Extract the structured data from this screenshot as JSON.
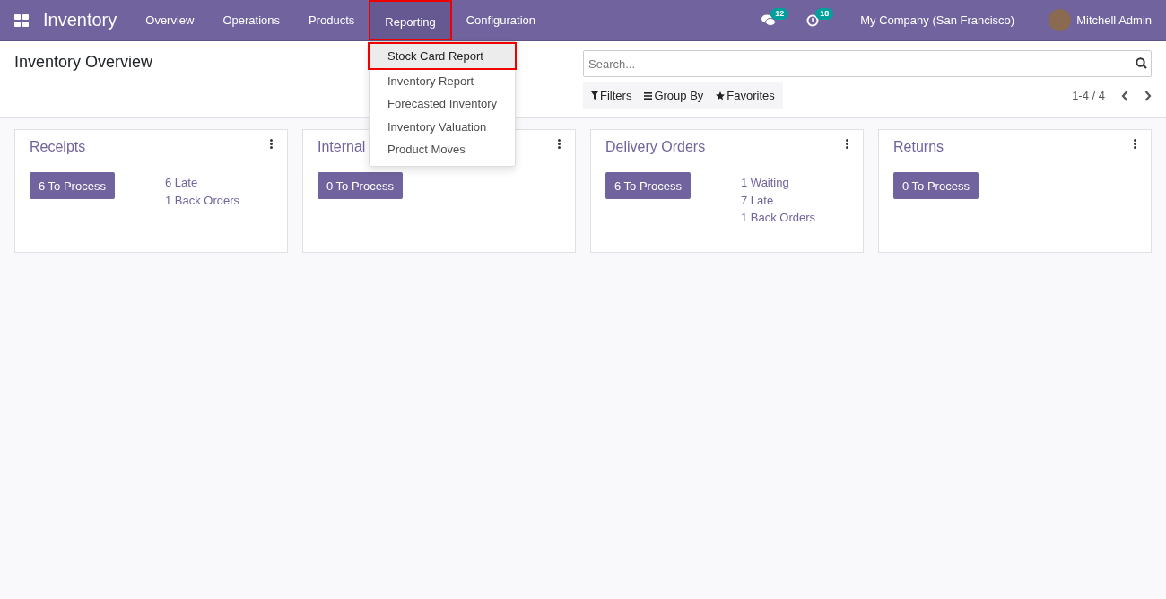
{
  "navbar": {
    "app_name": "Inventory",
    "menu": [
      {
        "label": "Overview",
        "selected": false,
        "annotated": false
      },
      {
        "label": "Operations",
        "selected": false,
        "annotated": false
      },
      {
        "label": "Products",
        "selected": false,
        "annotated": false
      },
      {
        "label": "Reporting",
        "selected": true,
        "annotated": true
      },
      {
        "label": "Configuration",
        "selected": false,
        "annotated": false
      }
    ],
    "messages_count": "12",
    "activities_count": "18",
    "company": "My Company (San Francisco)",
    "user": "Mitchell Admin"
  },
  "dropdown": [
    {
      "label": "Stock Card Report",
      "selected": true,
      "annotated": true
    },
    {
      "label": "Inventory Report",
      "selected": false,
      "annotated": false
    },
    {
      "label": "Forecasted Inventory",
      "selected": false,
      "annotated": false
    },
    {
      "label": "Inventory Valuation",
      "selected": false,
      "annotated": false
    },
    {
      "label": "Product Moves",
      "selected": false,
      "annotated": false
    }
  ],
  "control_panel": {
    "title": "Inventory Overview",
    "search": {
      "placeholder": "Search..."
    },
    "filters": [
      "Filters",
      "Group By",
      "Favorites"
    ],
    "pager": "1-4 / 4"
  },
  "cards": [
    {
      "title": "Receipts",
      "button": "6 To Process",
      "links": [
        "6 Late",
        "1 Back Orders"
      ]
    },
    {
      "title": "Internal",
      "button": "0 To Process"
    },
    {
      "title": "Delivery Orders",
      "button": "6 To Process",
      "links": [
        "1 Waiting",
        "7 Late",
        "1 Back Orders"
      ]
    },
    {
      "title": "Returns",
      "button": "0 To Process"
    }
  ]
}
